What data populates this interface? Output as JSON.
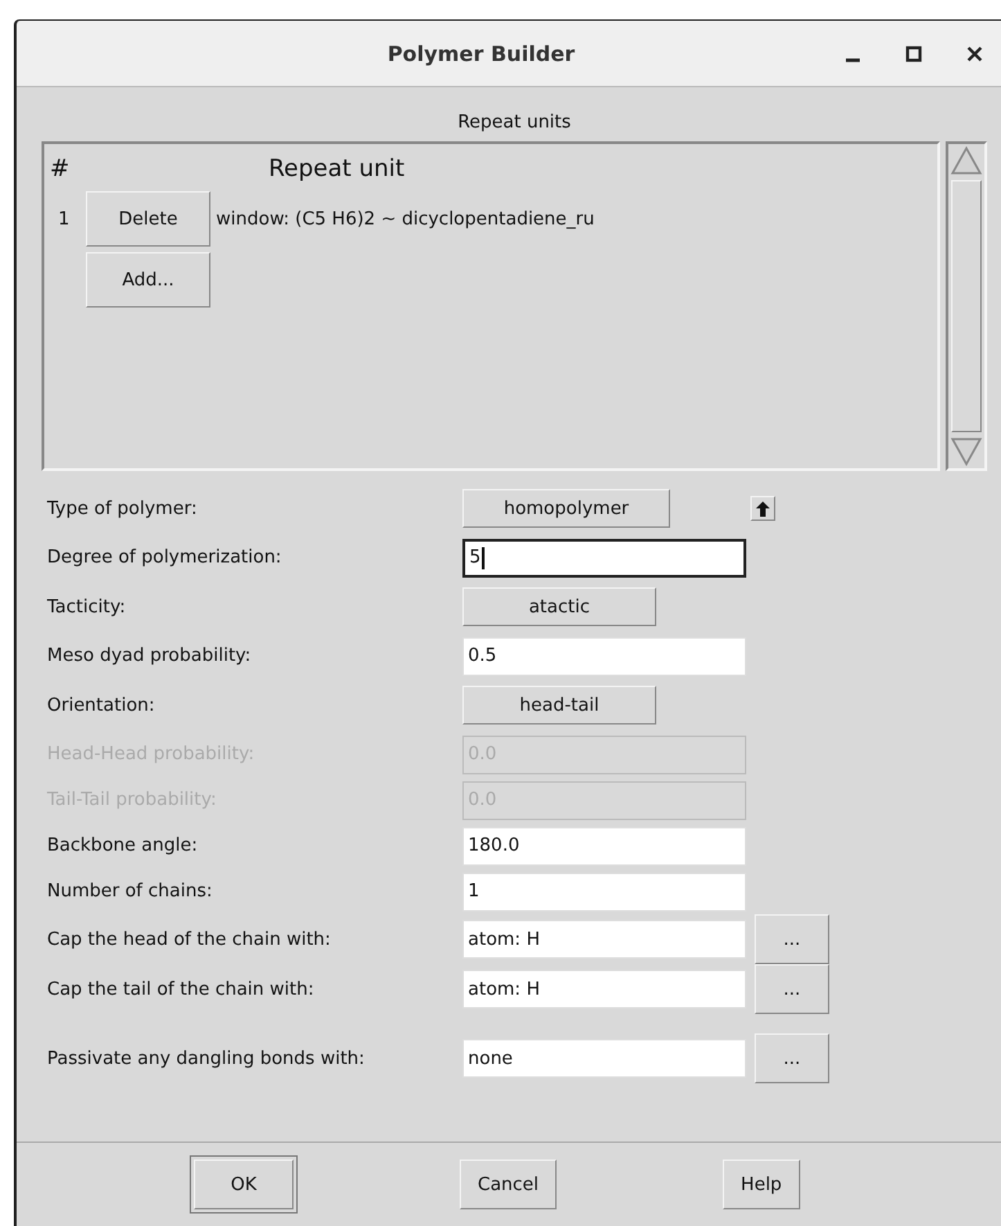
{
  "window": {
    "title": "Polymer Builder"
  },
  "repeat_units": {
    "heading": "Repeat units",
    "columns": [
      "#",
      "Repeat unit"
    ],
    "rows": [
      {
        "index": "1",
        "button": "Delete",
        "unit": "window: (C5 H6)2 ~ dicyclopentadiene_ru"
      }
    ],
    "add_button": "Add..."
  },
  "form": [
    {
      "kind": "menu_arrow",
      "label": "Type of polymer:",
      "value": "homopolymer",
      "disabled": false
    },
    {
      "kind": "entry",
      "label": "Degree of polymerization:",
      "value": "5",
      "disabled": false,
      "focused": true
    },
    {
      "kind": "menu",
      "label": "Tacticity:",
      "value": "atactic",
      "disabled": false
    },
    {
      "kind": "entry",
      "label": "Meso dyad probability:",
      "value": "0.5",
      "disabled": false,
      "focused": false
    },
    {
      "kind": "menu",
      "label": "Orientation:",
      "value": "head-tail",
      "disabled": false
    },
    {
      "kind": "entry",
      "label": "Head-Head probability:",
      "value": "0.0",
      "disabled": true,
      "focused": false
    },
    {
      "kind": "entry",
      "label": "Tail-Tail probability:",
      "value": "0.0",
      "disabled": true,
      "focused": false
    },
    {
      "kind": "entry",
      "label": "Backbone angle:",
      "value": "180.0",
      "disabled": false,
      "focused": false
    },
    {
      "kind": "entry",
      "label": "Number of chains:",
      "value": "1",
      "disabled": false,
      "focused": false
    },
    {
      "kind": "browse",
      "label": "Cap the head of the chain with:",
      "value": "atom: H",
      "button": "...",
      "disabled": false,
      "focused": false
    },
    {
      "kind": "browse",
      "label": "Cap the tail of the chain with:",
      "value": "atom: H",
      "button": "...",
      "disabled": false,
      "focused": false
    },
    {
      "kind": "browse",
      "label": "Passivate any dangling bonds with:",
      "value": "none",
      "button": "...",
      "disabled": false,
      "focused": false
    }
  ],
  "buttons": [
    {
      "label": "OK",
      "default": true
    },
    {
      "label": "Cancel",
      "default": false
    },
    {
      "label": "Help",
      "default": false
    }
  ]
}
